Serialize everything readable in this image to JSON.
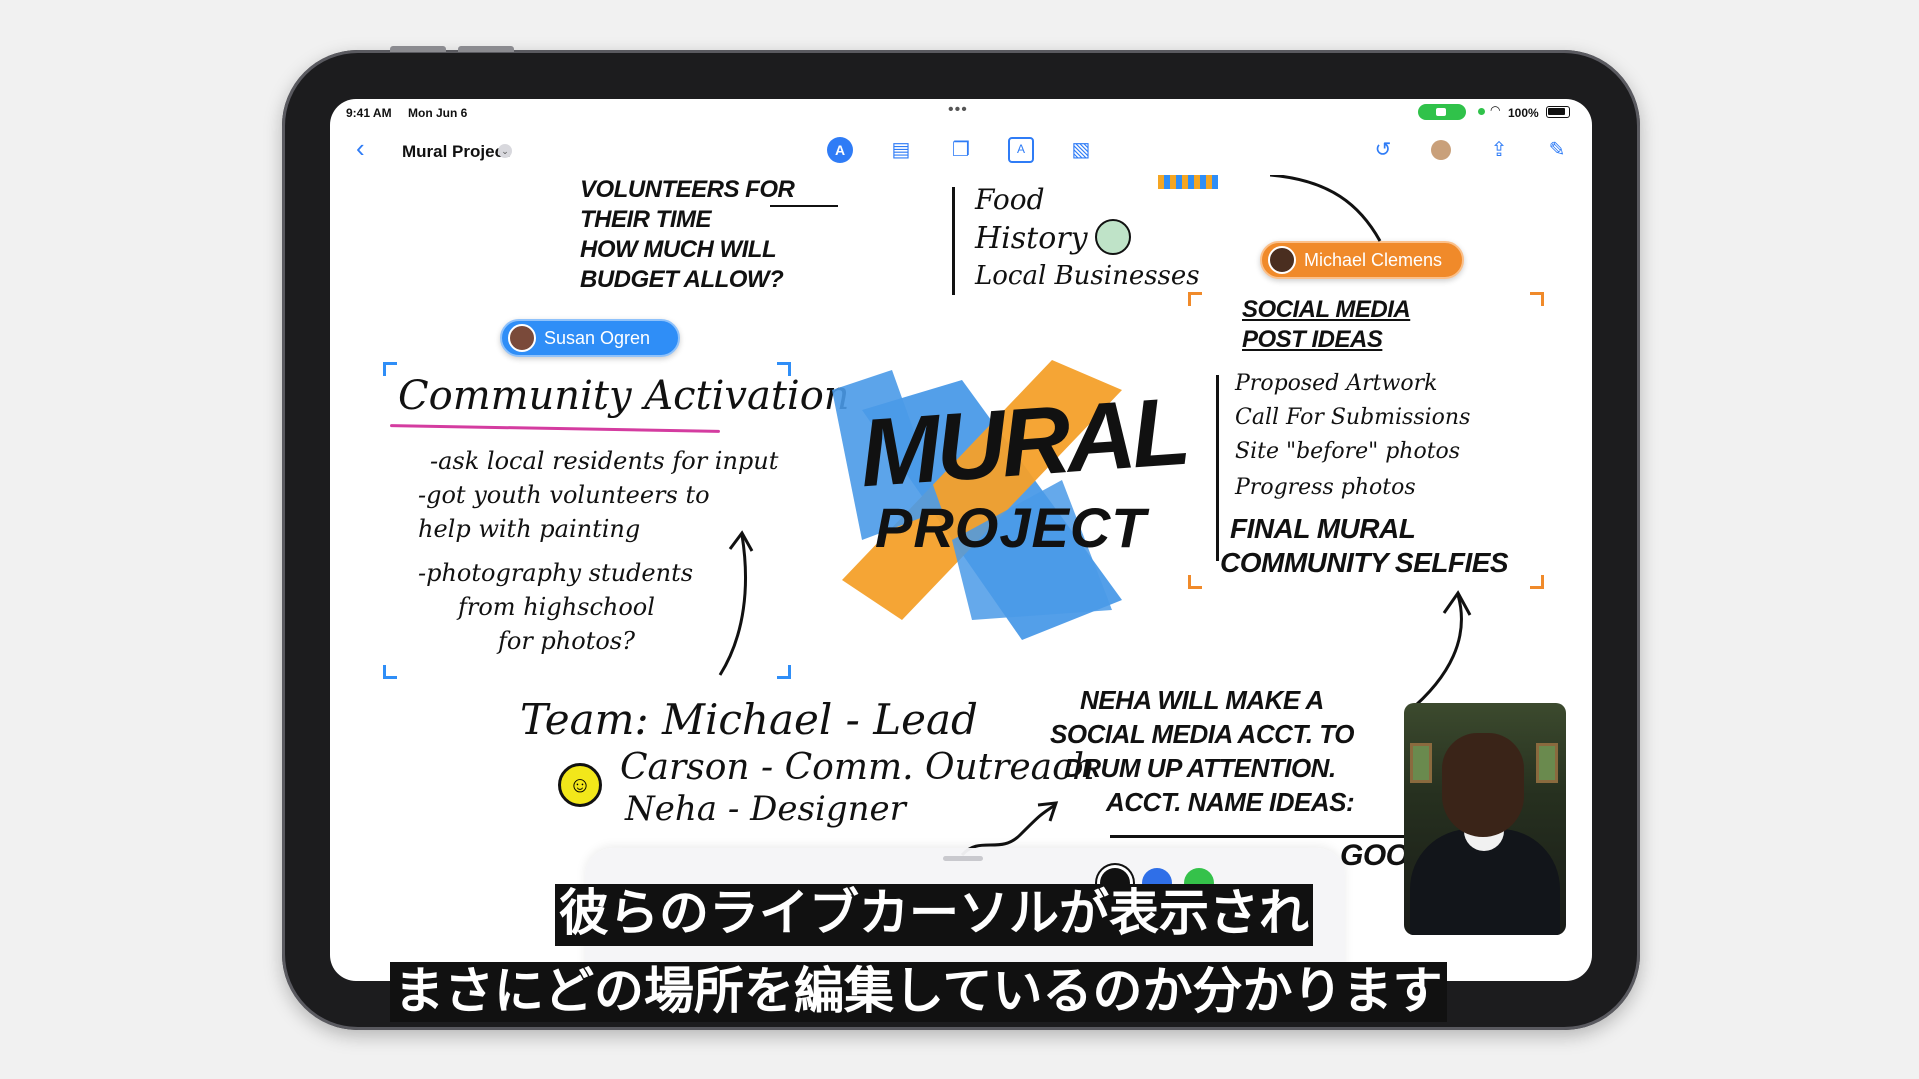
{
  "status_bar": {
    "time": "9:41 AM",
    "date": "Mon Jun 6",
    "battery": "100%"
  },
  "toolbar": {
    "title": "Mural Project",
    "back_icon": "chevron-left-icon",
    "tools": [
      "pen-tool-icon",
      "notes-icon",
      "shapes-icon",
      "text-box-icon",
      "media-icon"
    ],
    "right_tools": [
      "undo-icon",
      "collaborator-icon",
      "share-icon",
      "compose-icon"
    ]
  },
  "board": {
    "volunteers_note": [
      "VOLUNTEERS FOR",
      "THEIR TIME",
      "HOW MUCH WILL",
      "BUDGET ALLOW?"
    ],
    "topics": [
      "Food",
      "History",
      "Local Businesses"
    ],
    "community": {
      "heading": "Community Activation",
      "lines": [
        "-ask local residents for input",
        "-got youth volunteers to",
        "help with painting",
        "-photography students",
        "from highschool",
        "for photos?"
      ]
    },
    "mural_title": [
      "MURAL",
      "PROJECT"
    ],
    "social": {
      "heading": [
        "SOCIAL MEDIA",
        "POST IDEAS"
      ],
      "items": [
        "Proposed Artwork",
        "Call For Submissions",
        "Site \"before\" photos",
        "Progress photos",
        "FINAL MURAL",
        "COMMUNITY SELFIES"
      ]
    },
    "team": {
      "heading": "Team: Michael - Lead",
      "members": [
        "Carson - Comm. Outreach",
        "Neha - Designer"
      ]
    },
    "neha_note": [
      "NEHA WILL MAKE A",
      "SOCIAL MEDIA ACCT. TO",
      "DRUM UP ATTENTION.",
      "ACCT. NAME IDEAS:"
    ],
    "extra_fragment": "GOOD"
  },
  "collaborators": {
    "susan": "Susan Ogren",
    "michael": "Michael Clemens"
  },
  "colors": {
    "accent_blue": "#2f7cf6",
    "susan": "#2f8ef7",
    "michael": "#f08a2a"
  },
  "subtitles": {
    "line1": "彼らのライブカーソルが表示され",
    "line2": "まさにどの場所を編集しているのか分かります"
  }
}
